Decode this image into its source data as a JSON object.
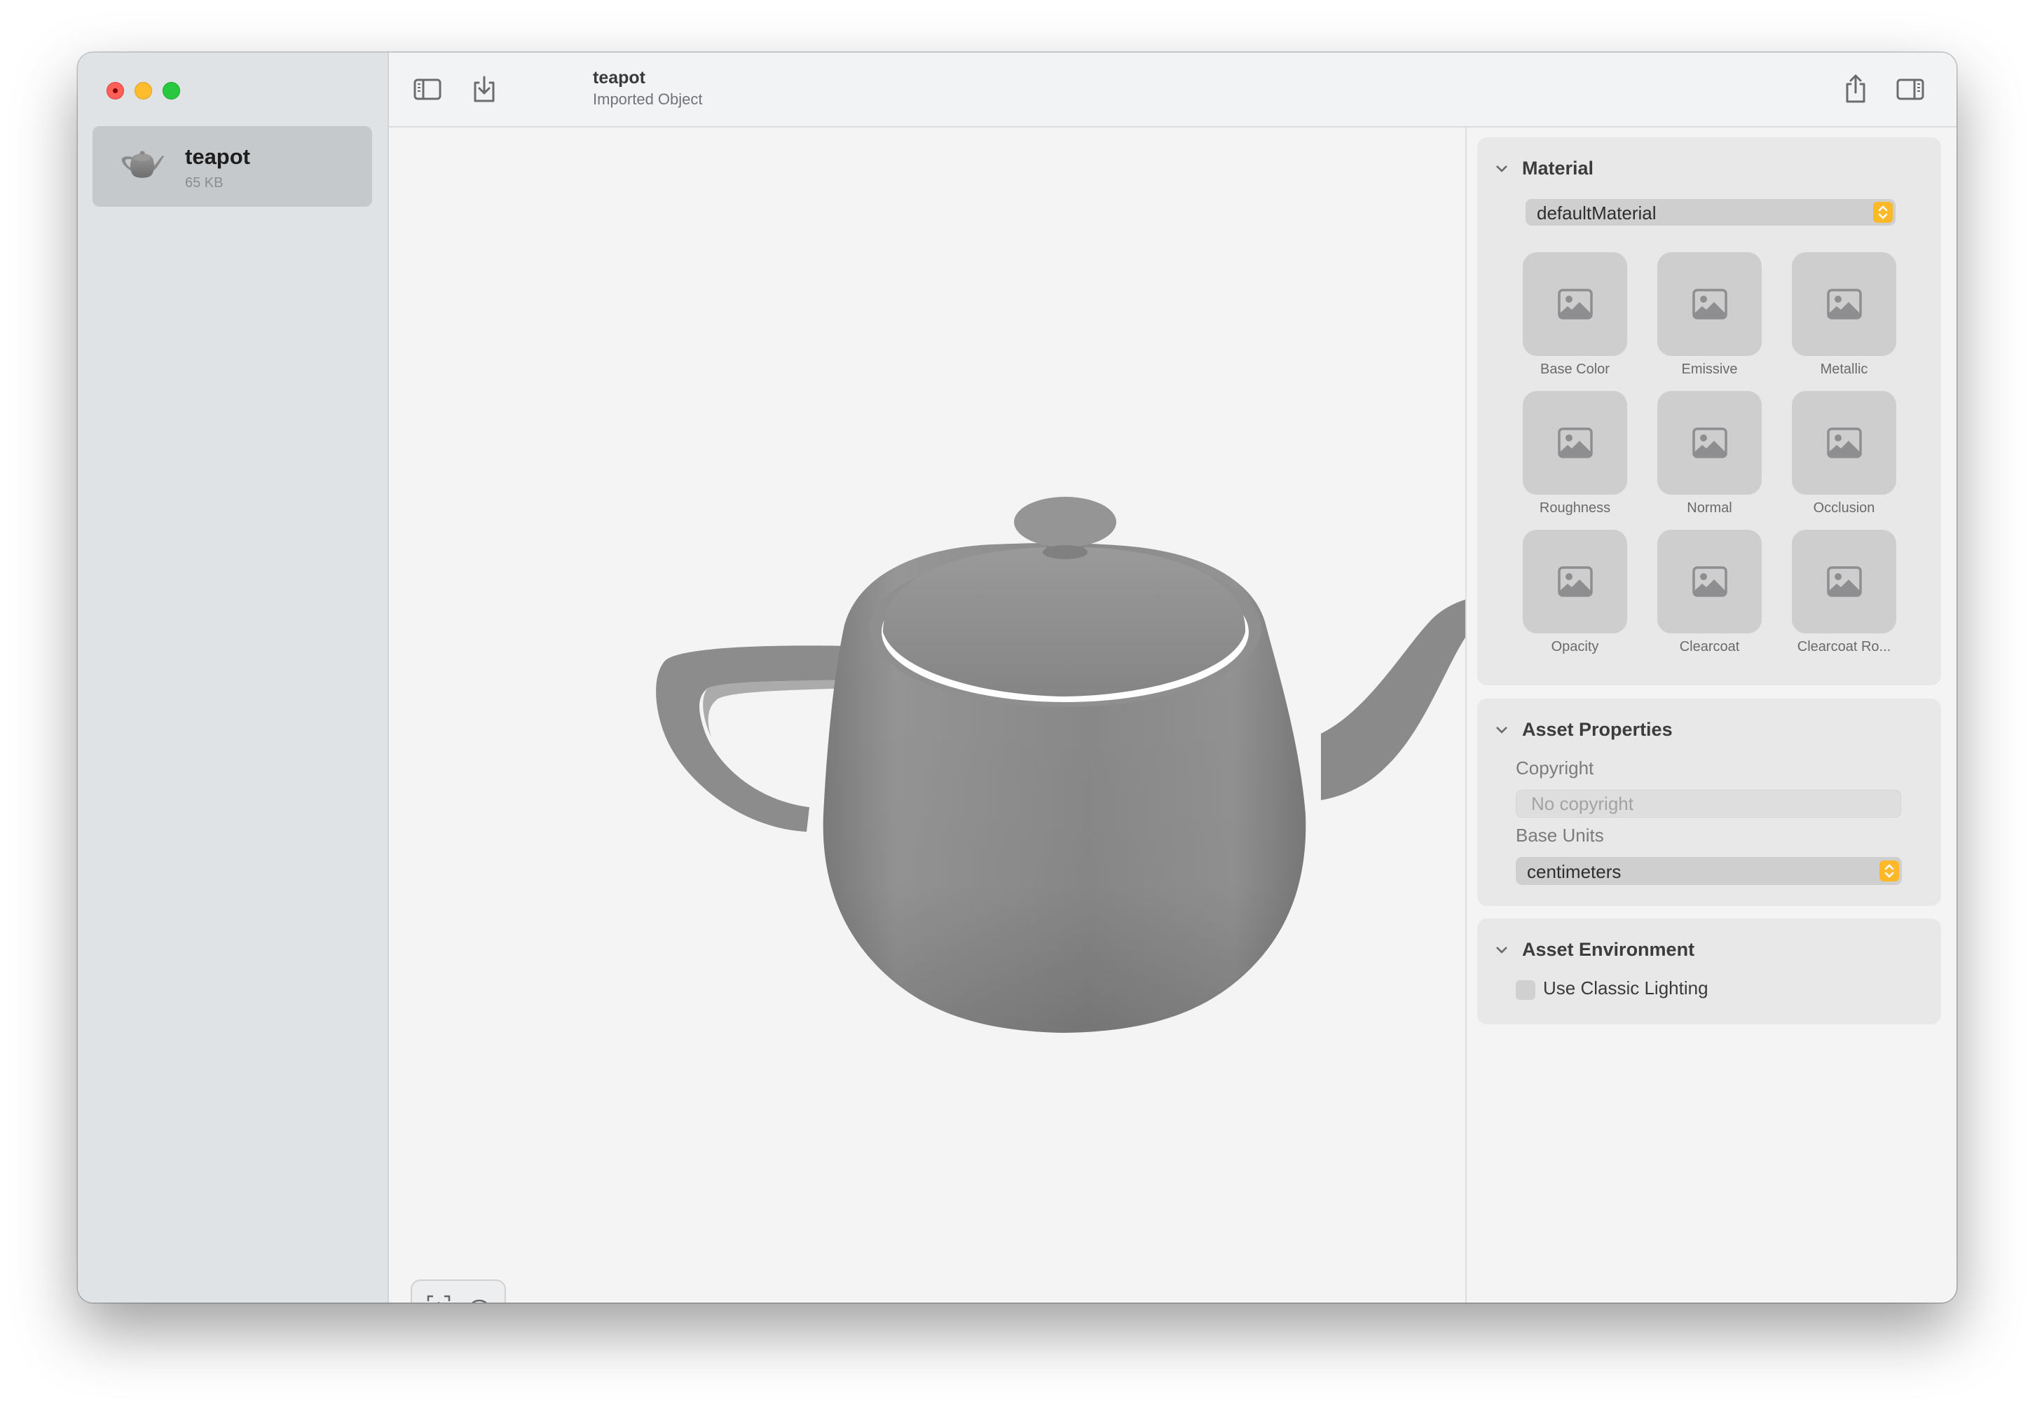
{
  "window": {
    "traffic_lights": [
      "close",
      "minimize",
      "zoom"
    ]
  },
  "sidebar": {
    "items": [
      {
        "name": "teapot",
        "size": "65 KB",
        "icon": "teapot-thumbnail",
        "selected": true
      }
    ]
  },
  "toolbar": {
    "title": "teapot",
    "subtitle": "Imported Object",
    "left_icons": [
      "sidebar-toggle-icon",
      "import-icon"
    ],
    "right_icons": [
      "share-icon",
      "inspector-toggle-icon"
    ]
  },
  "viewport": {
    "object": "teapot",
    "controls": [
      "frame-object-icon",
      "environment-dome-icon"
    ]
  },
  "inspector": {
    "material": {
      "title": "Material",
      "selected_material": "defaultMaterial",
      "textures": [
        {
          "label": "Base Color"
        },
        {
          "label": "Emissive"
        },
        {
          "label": "Metallic"
        },
        {
          "label": "Roughness"
        },
        {
          "label": "Normal"
        },
        {
          "label": "Occlusion"
        },
        {
          "label": "Opacity"
        },
        {
          "label": "Clearcoat"
        },
        {
          "label": "Clearcoat Ro..."
        }
      ]
    },
    "asset_properties": {
      "title": "Asset Properties",
      "copyright_label": "Copyright",
      "copyright_value": "",
      "copyright_placeholder": "No copyright",
      "base_units_label": "Base Units",
      "base_units_value": "centimeters"
    },
    "asset_environment": {
      "title": "Asset Environment",
      "classic_lighting_label": "Use Classic Lighting",
      "classic_lighting_checked": false
    }
  },
  "colors": {
    "accent_stepper": "#fdb92a",
    "close": "#ff5f57",
    "minimize": "#febc2e",
    "zoom": "#28c840"
  }
}
